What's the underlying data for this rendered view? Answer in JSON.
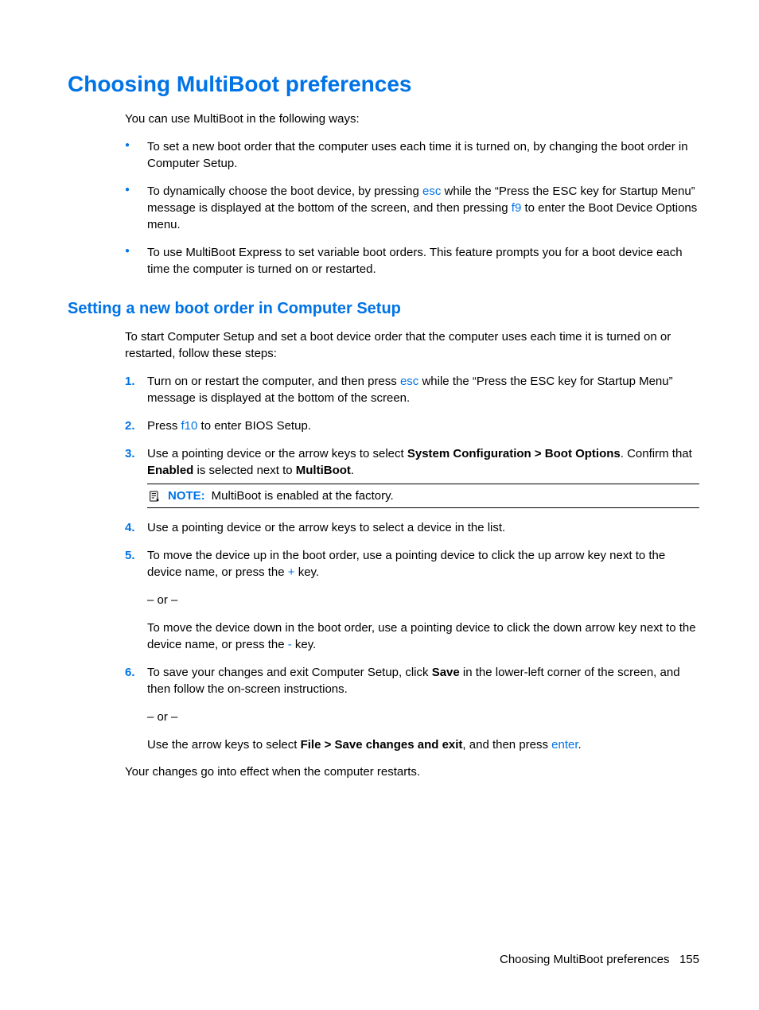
{
  "heading": "Choosing MultiBoot preferences",
  "intro": "You can use MultiBoot in the following ways:",
  "bullets": [
    {
      "segments": [
        {
          "t": "To set a new boot order that the computer uses each time it is turned on, by changing the boot order in Computer Setup."
        }
      ]
    },
    {
      "segments": [
        {
          "t": "To dynamically choose the boot device, by pressing "
        },
        {
          "t": "esc",
          "cls": "key"
        },
        {
          "t": " while the “Press the ESC key for Startup Menu” message is displayed at the bottom of the screen, and then pressing "
        },
        {
          "t": "f9",
          "cls": "key"
        },
        {
          "t": " to enter the Boot Device Options menu."
        }
      ]
    },
    {
      "segments": [
        {
          "t": "To use MultiBoot Express to set variable boot orders. This feature prompts you for a boot device each time the computer is turned on or restarted."
        }
      ]
    }
  ],
  "subheading": "Setting a new boot order in Computer Setup",
  "subintro": "To start Computer Setup and set a boot device order that the computer uses each time it is turned on or restarted, follow these steps:",
  "steps": [
    {
      "num": "1.",
      "segments": [
        {
          "t": "Turn on or restart the computer, and then press "
        },
        {
          "t": "esc",
          "cls": "key"
        },
        {
          "t": " while the “Press the ESC key for Startup Menu” message is displayed at the bottom of the screen."
        }
      ]
    },
    {
      "num": "2.",
      "segments": [
        {
          "t": "Press "
        },
        {
          "t": "f10",
          "cls": "key"
        },
        {
          "t": " to enter BIOS Setup."
        }
      ]
    },
    {
      "num": "3.",
      "segments": [
        {
          "t": "Use a pointing device or the arrow keys to select "
        },
        {
          "t": "System Configuration > Boot Options",
          "cls": "bold"
        },
        {
          "t": ". Confirm that "
        },
        {
          "t": "Enabled",
          "cls": "bold"
        },
        {
          "t": " is selected next to "
        },
        {
          "t": "MultiBoot",
          "cls": "bold"
        },
        {
          "t": "."
        }
      ],
      "note": {
        "label": "NOTE:",
        "text": "MultiBoot is enabled at the factory."
      }
    },
    {
      "num": "4.",
      "segments": [
        {
          "t": "Use a pointing device or the arrow keys to select a device in the list."
        }
      ]
    },
    {
      "num": "5.",
      "segments": [
        {
          "t": "To move the device up in the boot order, use a pointing device to click the up arrow key next to the device name, or press the "
        },
        {
          "t": "+",
          "cls": "key"
        },
        {
          "t": " key."
        }
      ],
      "subs": [
        [
          {
            "t": "– or –"
          }
        ],
        [
          {
            "t": "To move the device down in the boot order, use a pointing device to click the down arrow key next to the device name, or press the "
          },
          {
            "t": "-",
            "cls": "key"
          },
          {
            "t": " key."
          }
        ]
      ]
    },
    {
      "num": "6.",
      "segments": [
        {
          "t": "To save your changes and exit Computer Setup, click "
        },
        {
          "t": "Save",
          "cls": "bold"
        },
        {
          "t": " in the lower-left corner of the screen, and then follow the on-screen instructions."
        }
      ],
      "subs": [
        [
          {
            "t": "– or –"
          }
        ],
        [
          {
            "t": "Use the arrow keys to select "
          },
          {
            "t": "File > Save changes and exit",
            "cls": "bold"
          },
          {
            "t": ", and then press "
          },
          {
            "t": "enter",
            "cls": "key"
          },
          {
            "t": "."
          }
        ]
      ]
    }
  ],
  "closing": "Your changes go into effect when the computer restarts.",
  "footer_text": "Choosing MultiBoot preferences",
  "footer_page": "155"
}
